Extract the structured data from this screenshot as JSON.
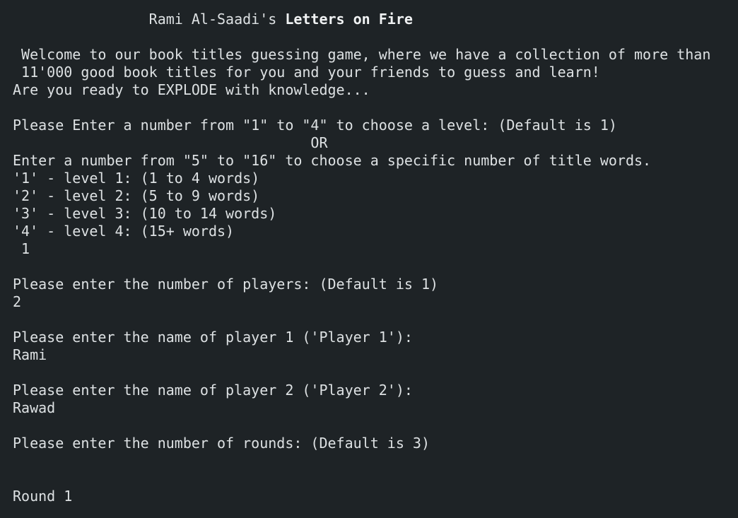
{
  "header": {
    "title_prefix": "                Rami Al-Saadi's ",
    "title_bold": "Letters on Fire"
  },
  "intro": {
    "line1": " Welcome to our book titles guessing game, where we have a collection of more than",
    "line2": " 11'000 good book titles for you and your friends to guess and learn!",
    "line3": "Are you ready to EXPLODE with knowledge..."
  },
  "level_prompt": {
    "line1": "Please Enter a number from \"1\" to \"4\" to choose a level: (Default is 1)",
    "or": "                                   OR",
    "line2": "Enter a number from \"5\" to \"16\" to choose a specific number of title words.",
    "options": [
      "'1' - level 1: (1 to 4 words)",
      "'2' - level 2: (5 to 9 words)",
      "'3' - level 3: (10 to 14 words)",
      "'4' - level 4: (15+ words)"
    ],
    "input": " 1"
  },
  "players_prompt": {
    "text": "Please enter the number of players: (Default is 1)",
    "input": "2"
  },
  "player1_prompt": {
    "text": "Please enter the name of player 1 ('Player 1'):",
    "input": "Rami"
  },
  "player2_prompt": {
    "text": "Please enter the name of player 2 ('Player 2'):",
    "input": "Rawad"
  },
  "rounds_prompt": {
    "text": "Please enter the number of rounds: (Default is 3)",
    "input": ""
  },
  "round_label": "Round 1"
}
